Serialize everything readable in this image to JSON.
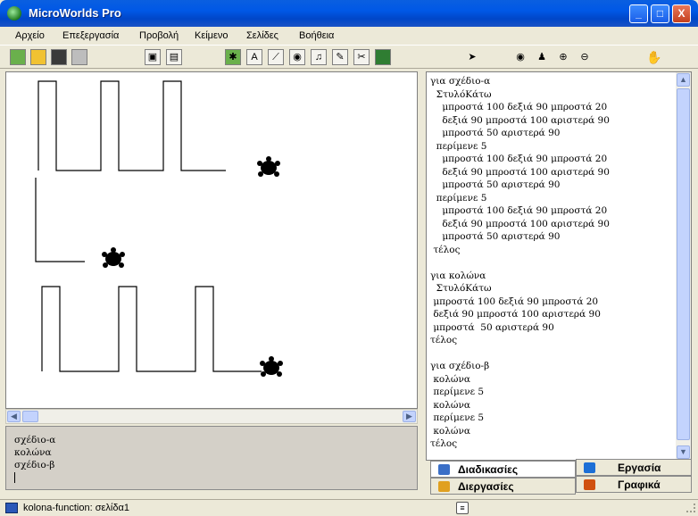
{
  "window": {
    "title": "MicroWorlds Pro",
    "controls": [
      "_",
      "□",
      "X"
    ]
  },
  "menu": [
    "Αρχείο",
    "Επεξεργασία",
    "Προβολή",
    "Κείμενο",
    "Σελίδες",
    "Βοήθεια"
  ],
  "toolbar": {
    "icons": [
      "new-page-icon",
      "open-folder-icon",
      "save-icon",
      "print-icon",
      "page-view-icon",
      "text-view-icon",
      "new-turtle-icon",
      "text-box-icon",
      "slider-icon",
      "button-icon",
      "music-icon",
      "paint-icon",
      "cut-icon",
      "run-icon",
      "pointer-icon",
      "eye-icon",
      "stamp-icon",
      "zoom-in-icon",
      "zoom-out-icon",
      "stop-icon"
    ]
  },
  "command_center": {
    "lines": [
      "σχέδιο-α",
      "κολώνα",
      "σχέδιο-β"
    ]
  },
  "procedures": {
    "lines": [
      "για σχέδιο-α",
      "  ΣτυλόΚάτω",
      "    μπροστά 100 δεξιά 90 μπροστά 20",
      "    δεξιά 90 μπροστά 100 αριστερά 90",
      "    μπροστά 50 αριστερά 90",
      "  περίμενε 5",
      "    μπροστά 100 δεξιά 90 μπροστά 20",
      "    δεξιά 90 μπροστά 100 αριστερά 90",
      "    μπροστά 50 αριστερά 90",
      "  περίμενε 5",
      "    μπροστά 100 δεξιά 90 μπροστά 20",
      "    δεξιά 90 μπροστά 100 αριστερά 90",
      "    μπροστά 50 αριστερά 90",
      " τέλος",
      "",
      "για κολώνα",
      "  ΣτυλόΚάτω",
      " μπροστά 100 δεξιά 90 μπροστά 20",
      " δεξιά 90 μπροστά 100 αριστερά 90",
      " μπροστά  50 αριστερά 90",
      "τέλος",
      "",
      "για σχέδιο-β",
      " κολώνα",
      " περίμενε 5",
      " κολώνα",
      " περίμενε 5",
      " κολώνα",
      "τέλος"
    ]
  },
  "tabs": [
    {
      "label": "Διαδικασίες",
      "icon": "procedures-tab-icon",
      "color": "#3b6fc7",
      "active": true
    },
    {
      "label": "Εργασία",
      "icon": "project-tab-icon",
      "color": "#1d6fd6",
      "active": false
    },
    {
      "label": "Διεργασίες",
      "icon": "processes-tab-icon",
      "color": "#e0a020",
      "active": false
    },
    {
      "label": "Γραφικά",
      "icon": "graphics-tab-icon",
      "color": "#d05010",
      "active": false
    }
  ],
  "status": {
    "text": "kolona-function:  σελίδα1"
  }
}
